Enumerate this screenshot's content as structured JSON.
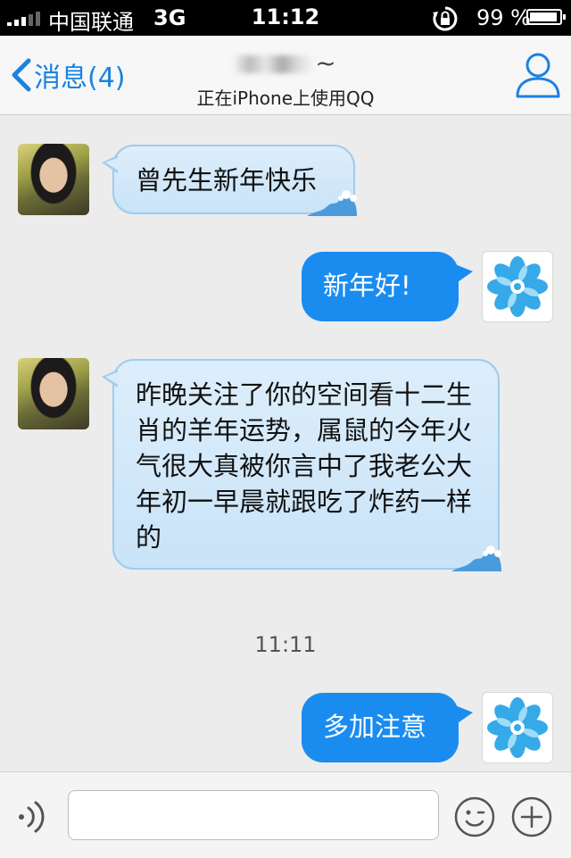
{
  "status_bar": {
    "carrier": "中国联通",
    "network": "3G",
    "time": "11:12",
    "battery": "99 %",
    "battery_level": 0.99
  },
  "nav": {
    "back_label": "消息(4)",
    "contact_suffix": "~",
    "subtitle": "正在iPhone上使用QQ"
  },
  "messages": [
    {
      "direction": "in",
      "text": "曾先生新年快乐"
    },
    {
      "direction": "out",
      "text": "新年好!"
    },
    {
      "direction": "in",
      "text": "昨晚关注了你的空间看十二生肖的羊年运势，属鼠的今年火气很大真被你言中了我老公大年初一早晨就跟吃了炸药一样的"
    },
    {
      "direction": "out",
      "text": "多加注意"
    }
  ],
  "timestamp": "11:11",
  "icons": {
    "back": "chevron-left-icon",
    "profile": "person-icon",
    "voice": "voice-icon",
    "emoji": "smiley-icon",
    "more": "plus-icon"
  },
  "colors": {
    "accent": "#1a82e2",
    "outgoing_bubble": "#1a8cf0",
    "incoming_bubble": "#d6eafa"
  }
}
